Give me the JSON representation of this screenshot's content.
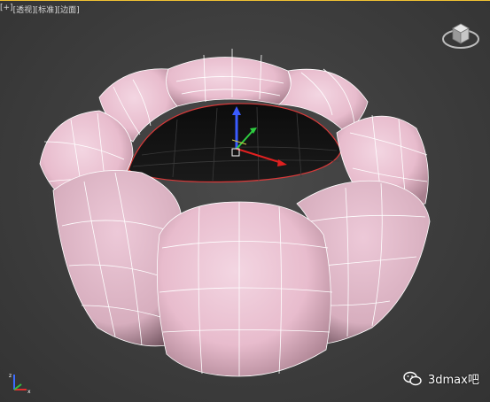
{
  "viewport": {
    "labels": [
      "[+]",
      "[透视]",
      "[标准]",
      "[边面]"
    ]
  },
  "watermark": {
    "text": "3dmax吧"
  },
  "object": {
    "name": "torus",
    "color": "#ebc4d3",
    "wire_color": "#ffffff",
    "selected_edge_color": "#e23030"
  },
  "icons": [
    "viewcube-icon",
    "axis-tripod-icon",
    "transform-gizmo-icon",
    "wechat-icon"
  ]
}
